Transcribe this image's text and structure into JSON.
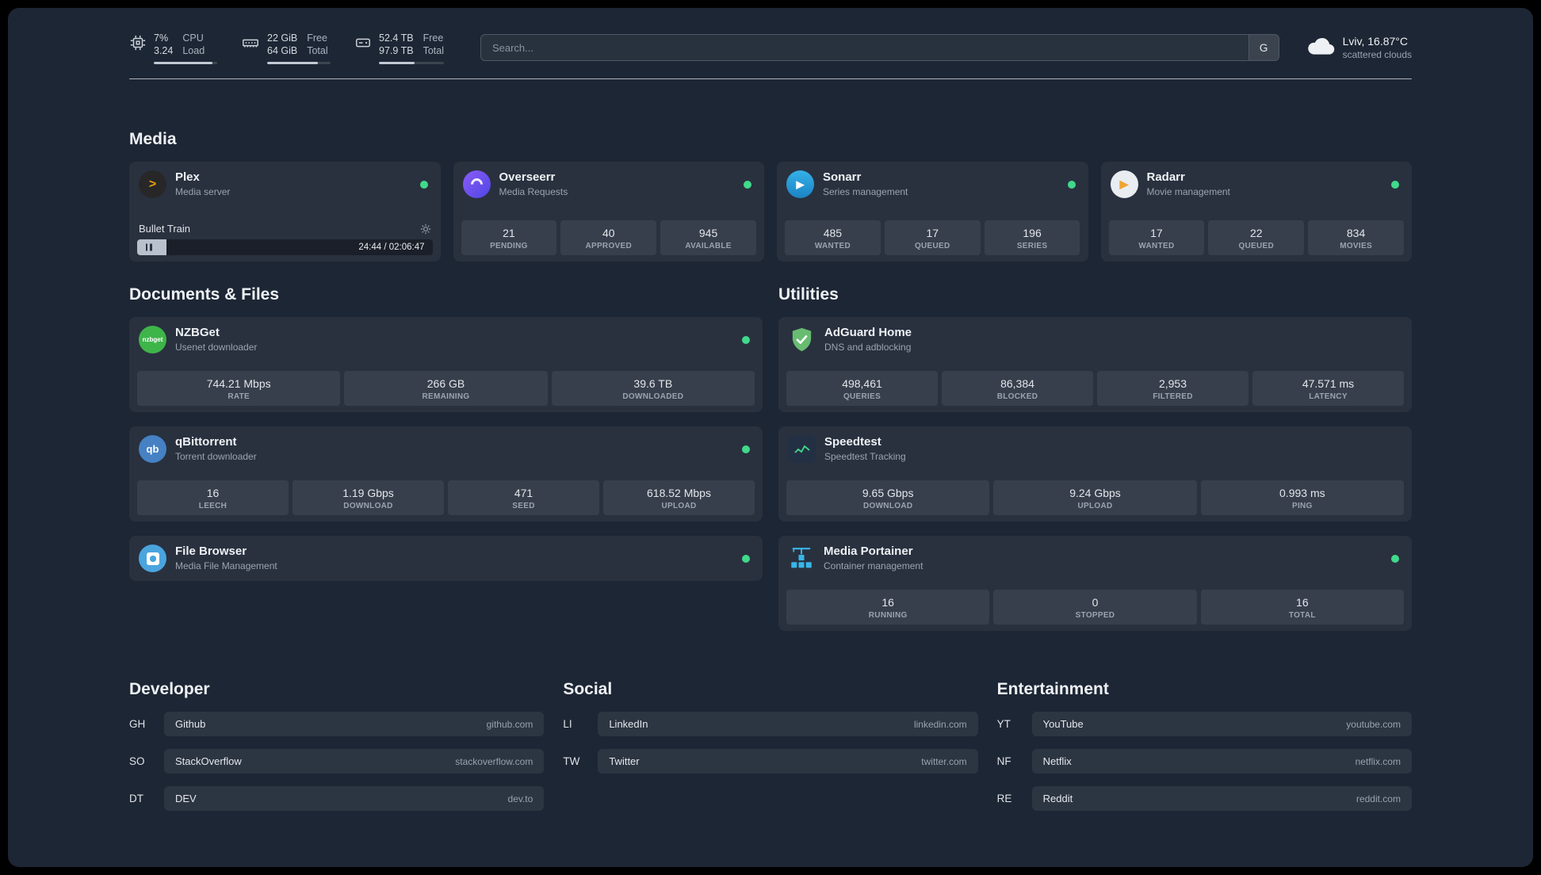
{
  "theme": {
    "background": "#1d2634",
    "status_online": "#41d98b",
    "accent_green": "#3fd98c",
    "plex_brand": "#e5a00d",
    "nzbget_brand": "#3eb549",
    "qbittorrent_brand": "#4581c3",
    "adguard_brand": "#68bc71",
    "portainer_brand": "#38b6e8"
  },
  "topbar": {
    "cpu": {
      "percent": "7%",
      "load": "3.24",
      "label_top": "CPU",
      "label_bottom": "Load",
      "bar_percent": 93
    },
    "memory": {
      "free": "22 GiB",
      "total": "64 GiB",
      "label_top": "Free",
      "label_bottom": "Total",
      "bar_percent": 80
    },
    "disk": {
      "free": "52.4 TB",
      "total": "97.9 TB",
      "label_top": "Free",
      "label_bottom": "Total",
      "bar_percent": 55
    },
    "search": {
      "placeholder": "Search...",
      "provider_label": "G"
    },
    "weather": {
      "location": "Lviv, 16.87°C",
      "condition": "scattered clouds"
    }
  },
  "media": {
    "title": "Media",
    "plex": {
      "name": "Plex",
      "desc": "Media server",
      "status": "online",
      "track": "Bullet Train",
      "time": "24:44 / 02:06:47",
      "progress_percent": 10
    },
    "overseerr": {
      "name": "Overseerr",
      "desc": "Media Requests",
      "status": "online",
      "stats": [
        {
          "value": "21",
          "label": "PENDING"
        },
        {
          "value": "40",
          "label": "APPROVED"
        },
        {
          "value": "945",
          "label": "AVAILABLE"
        }
      ]
    },
    "sonarr": {
      "name": "Sonarr",
      "desc": "Series management",
      "status": "online",
      "stats": [
        {
          "value": "485",
          "label": "WANTED"
        },
        {
          "value": "17",
          "label": "QUEUED"
        },
        {
          "value": "196",
          "label": "SERIES"
        }
      ]
    },
    "radarr": {
      "name": "Radarr",
      "desc": "Movie management",
      "status": "online",
      "stats": [
        {
          "value": "17",
          "label": "WANTED"
        },
        {
          "value": "22",
          "label": "QUEUED"
        },
        {
          "value": "834",
          "label": "MOVIES"
        }
      ]
    }
  },
  "documents": {
    "title": "Documents & Files",
    "nzbget": {
      "name": "NZBGet",
      "desc": "Usenet downloader",
      "status": "online",
      "icon_text": "nzbget",
      "stats": [
        {
          "value": "744.21 Mbps",
          "label": "RATE"
        },
        {
          "value": "266 GB",
          "label": "REMAINING"
        },
        {
          "value": "39.6 TB",
          "label": "DOWNLOADED"
        }
      ]
    },
    "qbittorrent": {
      "name": "qBittorrent",
      "desc": "Torrent downloader",
      "status": "online",
      "icon_text": "qb",
      "stats": [
        {
          "value": "16",
          "label": "LEECH"
        },
        {
          "value": "1.19 Gbps",
          "label": "DOWNLOAD"
        },
        {
          "value": "471",
          "label": "SEED"
        },
        {
          "value": "618.52 Mbps",
          "label": "UPLOAD"
        }
      ]
    },
    "filebrowser": {
      "name": "File Browser",
      "desc": "Media File Management",
      "status": "online"
    }
  },
  "utilities": {
    "title": "Utilities",
    "adguard": {
      "name": "AdGuard Home",
      "desc": "DNS and adblocking",
      "stats": [
        {
          "value": "498,461",
          "label": "QUERIES"
        },
        {
          "value": "86,384",
          "label": "BLOCKED"
        },
        {
          "value": "2,953",
          "label": "FILTERED"
        },
        {
          "value": "47.571 ms",
          "label": "LATENCY"
        }
      ]
    },
    "speedtest": {
      "name": "Speedtest",
      "desc": "Speedtest Tracking",
      "stats": [
        {
          "value": "9.65 Gbps",
          "label": "DOWNLOAD"
        },
        {
          "value": "9.24 Gbps",
          "label": "UPLOAD"
        },
        {
          "value": "0.993 ms",
          "label": "PING"
        }
      ]
    },
    "portainer": {
      "name": "Media Portainer",
      "desc": "Container management",
      "status": "online",
      "stats": [
        {
          "value": "16",
          "label": "RUNNING"
        },
        {
          "value": "0",
          "label": "STOPPED"
        },
        {
          "value": "16",
          "label": "TOTAL"
        }
      ]
    }
  },
  "bookmarks": {
    "developer": {
      "title": "Developer",
      "items": [
        {
          "abbr": "GH",
          "name": "Github",
          "domain": "github.com"
        },
        {
          "abbr": "SO",
          "name": "StackOverflow",
          "domain": "stackoverflow.com"
        },
        {
          "abbr": "DT",
          "name": "DEV",
          "domain": "dev.to"
        }
      ]
    },
    "social": {
      "title": "Social",
      "items": [
        {
          "abbr": "LI",
          "name": "LinkedIn",
          "domain": "linkedin.com"
        },
        {
          "abbr": "TW",
          "name": "Twitter",
          "domain": "twitter.com"
        }
      ]
    },
    "entertainment": {
      "title": "Entertainment",
      "items": [
        {
          "abbr": "YT",
          "name": "YouTube",
          "domain": "youtube.com"
        },
        {
          "abbr": "NF",
          "name": "Netflix",
          "domain": "netflix.com"
        },
        {
          "abbr": "RE",
          "name": "Reddit",
          "domain": "reddit.com"
        }
      ]
    }
  }
}
